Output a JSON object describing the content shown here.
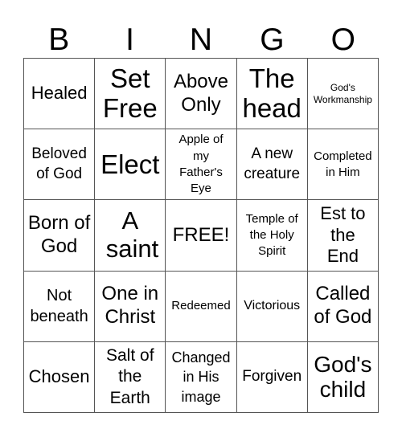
{
  "header": {
    "letters": [
      "B",
      "I",
      "N",
      "G",
      "O"
    ]
  },
  "grid": {
    "rows": [
      [
        "Healed",
        "Set Free",
        "Above Only",
        "The head",
        "God's Workmanship"
      ],
      [
        "Beloved of God",
        "Elect",
        "Apple of my Father's Eye",
        "A new creature",
        "Completed in Him"
      ],
      [
        "Born of God",
        "A saint",
        "FREE!",
        "Temple of the Holy Spirit",
        "Est to the End"
      ],
      [
        "Not beneath",
        "One in Christ",
        "Redeemed",
        "Victorious",
        "Called of God"
      ],
      [
        "Chosen",
        "Salt of the Earth",
        "Changed in His image",
        "Forgiven",
        "God's child"
      ]
    ]
  },
  "colors": {
    "grid_line": "#555555",
    "text": "#000000",
    "background": "#ffffff"
  }
}
